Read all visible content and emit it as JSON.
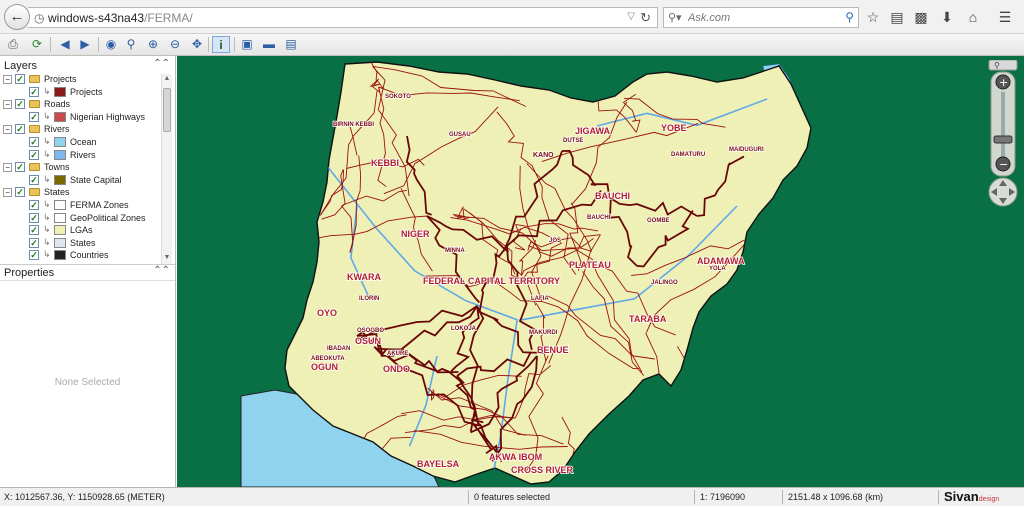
{
  "browser": {
    "url_host": "windows-s43na43",
    "url_path": "/FERMA/",
    "search_placeholder": "Ask.com"
  },
  "layers_panel": {
    "title": "Layers",
    "items": [
      {
        "label": "Projects",
        "type": "group"
      },
      {
        "label": "Projects",
        "type": "layer",
        "swatch": "#8a1a1a"
      },
      {
        "label": "Roads",
        "type": "group"
      },
      {
        "label": "Nigerian Highways",
        "type": "layer",
        "swatch": "#c84a4a"
      },
      {
        "label": "Rivers",
        "type": "group"
      },
      {
        "label": "Ocean",
        "type": "layer",
        "swatch": "#8fd3ee"
      },
      {
        "label": "Rivers",
        "type": "layer",
        "swatch": "#7fb8f0"
      },
      {
        "label": "Towns",
        "type": "group"
      },
      {
        "label": "State Capital",
        "type": "layer",
        "swatch": "#7a6a00"
      },
      {
        "label": "States",
        "type": "group"
      },
      {
        "label": "FERMA Zones",
        "type": "layer",
        "swatch": "#ffffff"
      },
      {
        "label": "GeoPolitical Zones",
        "type": "layer",
        "swatch": "#ffffff"
      },
      {
        "label": "LGAs",
        "type": "layer",
        "swatch": "#eef0b6"
      },
      {
        "label": "States",
        "type": "layer",
        "swatch": "#dfe6f2"
      },
      {
        "label": "Countries",
        "type": "layer",
        "swatch": "#222222"
      }
    ]
  },
  "properties_panel": {
    "title": "Properties",
    "empty_text": "None Selected"
  },
  "map": {
    "colors": {
      "background": "#087044",
      "land": "#eef0b6",
      "ocean": "#8fd3ee",
      "roads": "#9b1010",
      "rivers": "#5fa8e8"
    },
    "labels": {
      "sokoto": "SOKOTO",
      "birnin_kebbi": "BIRNIN KEBBI",
      "jigawa": "JIGAWA",
      "yobe": "YOBE",
      "kebbi": "KEBBI",
      "kano": "KANO",
      "damaturu": "DAMATURU",
      "maiduguri": "MAIDUGURI",
      "gusau": "GUSAU",
      "dutse": "DUTSE",
      "bauchi_state": "BAUCHI",
      "bauchi_city": "BAUCHI",
      "gombe": "GOMBE",
      "niger": "NIGER",
      "minna": "MINNA",
      "jos": "JOS",
      "plateau": "PLATEAU",
      "adamawa": "ADAMAWA",
      "yola": "YOLA",
      "kwara": "KWARA",
      "fct": "FEDERAL CAPITAL TERRITORY",
      "jalingo": "JALINGO",
      "lafia": "LAFIA",
      "ilorin": "ILORIN",
      "taraba": "TARABA",
      "oyo": "OYO",
      "osogbo": "OSOGBO",
      "osun": "OSUN",
      "ibadan": "IBADAN",
      "lokoja": "LOKOJA",
      "makurdi": "MAKURDI",
      "akure": "AKURE",
      "benue": "BENUE",
      "abeokuta": "ABEOKUTA",
      "ogun": "OGUN",
      "ondo": "ONDO",
      "bayelsa": "BAYELSA",
      "akwa_ibom": "AKWA IBOM",
      "cross_river": "CROSS RIVER"
    }
  },
  "status": {
    "coords": "X: 1012567.36, Y: 1150928.65 (METER)",
    "features": "0 features selected",
    "scale": "1: 7196090",
    "extent": "2151.48 x 1096.68 (km)",
    "brand": "Sivan",
    "brand_suffix": "design"
  }
}
